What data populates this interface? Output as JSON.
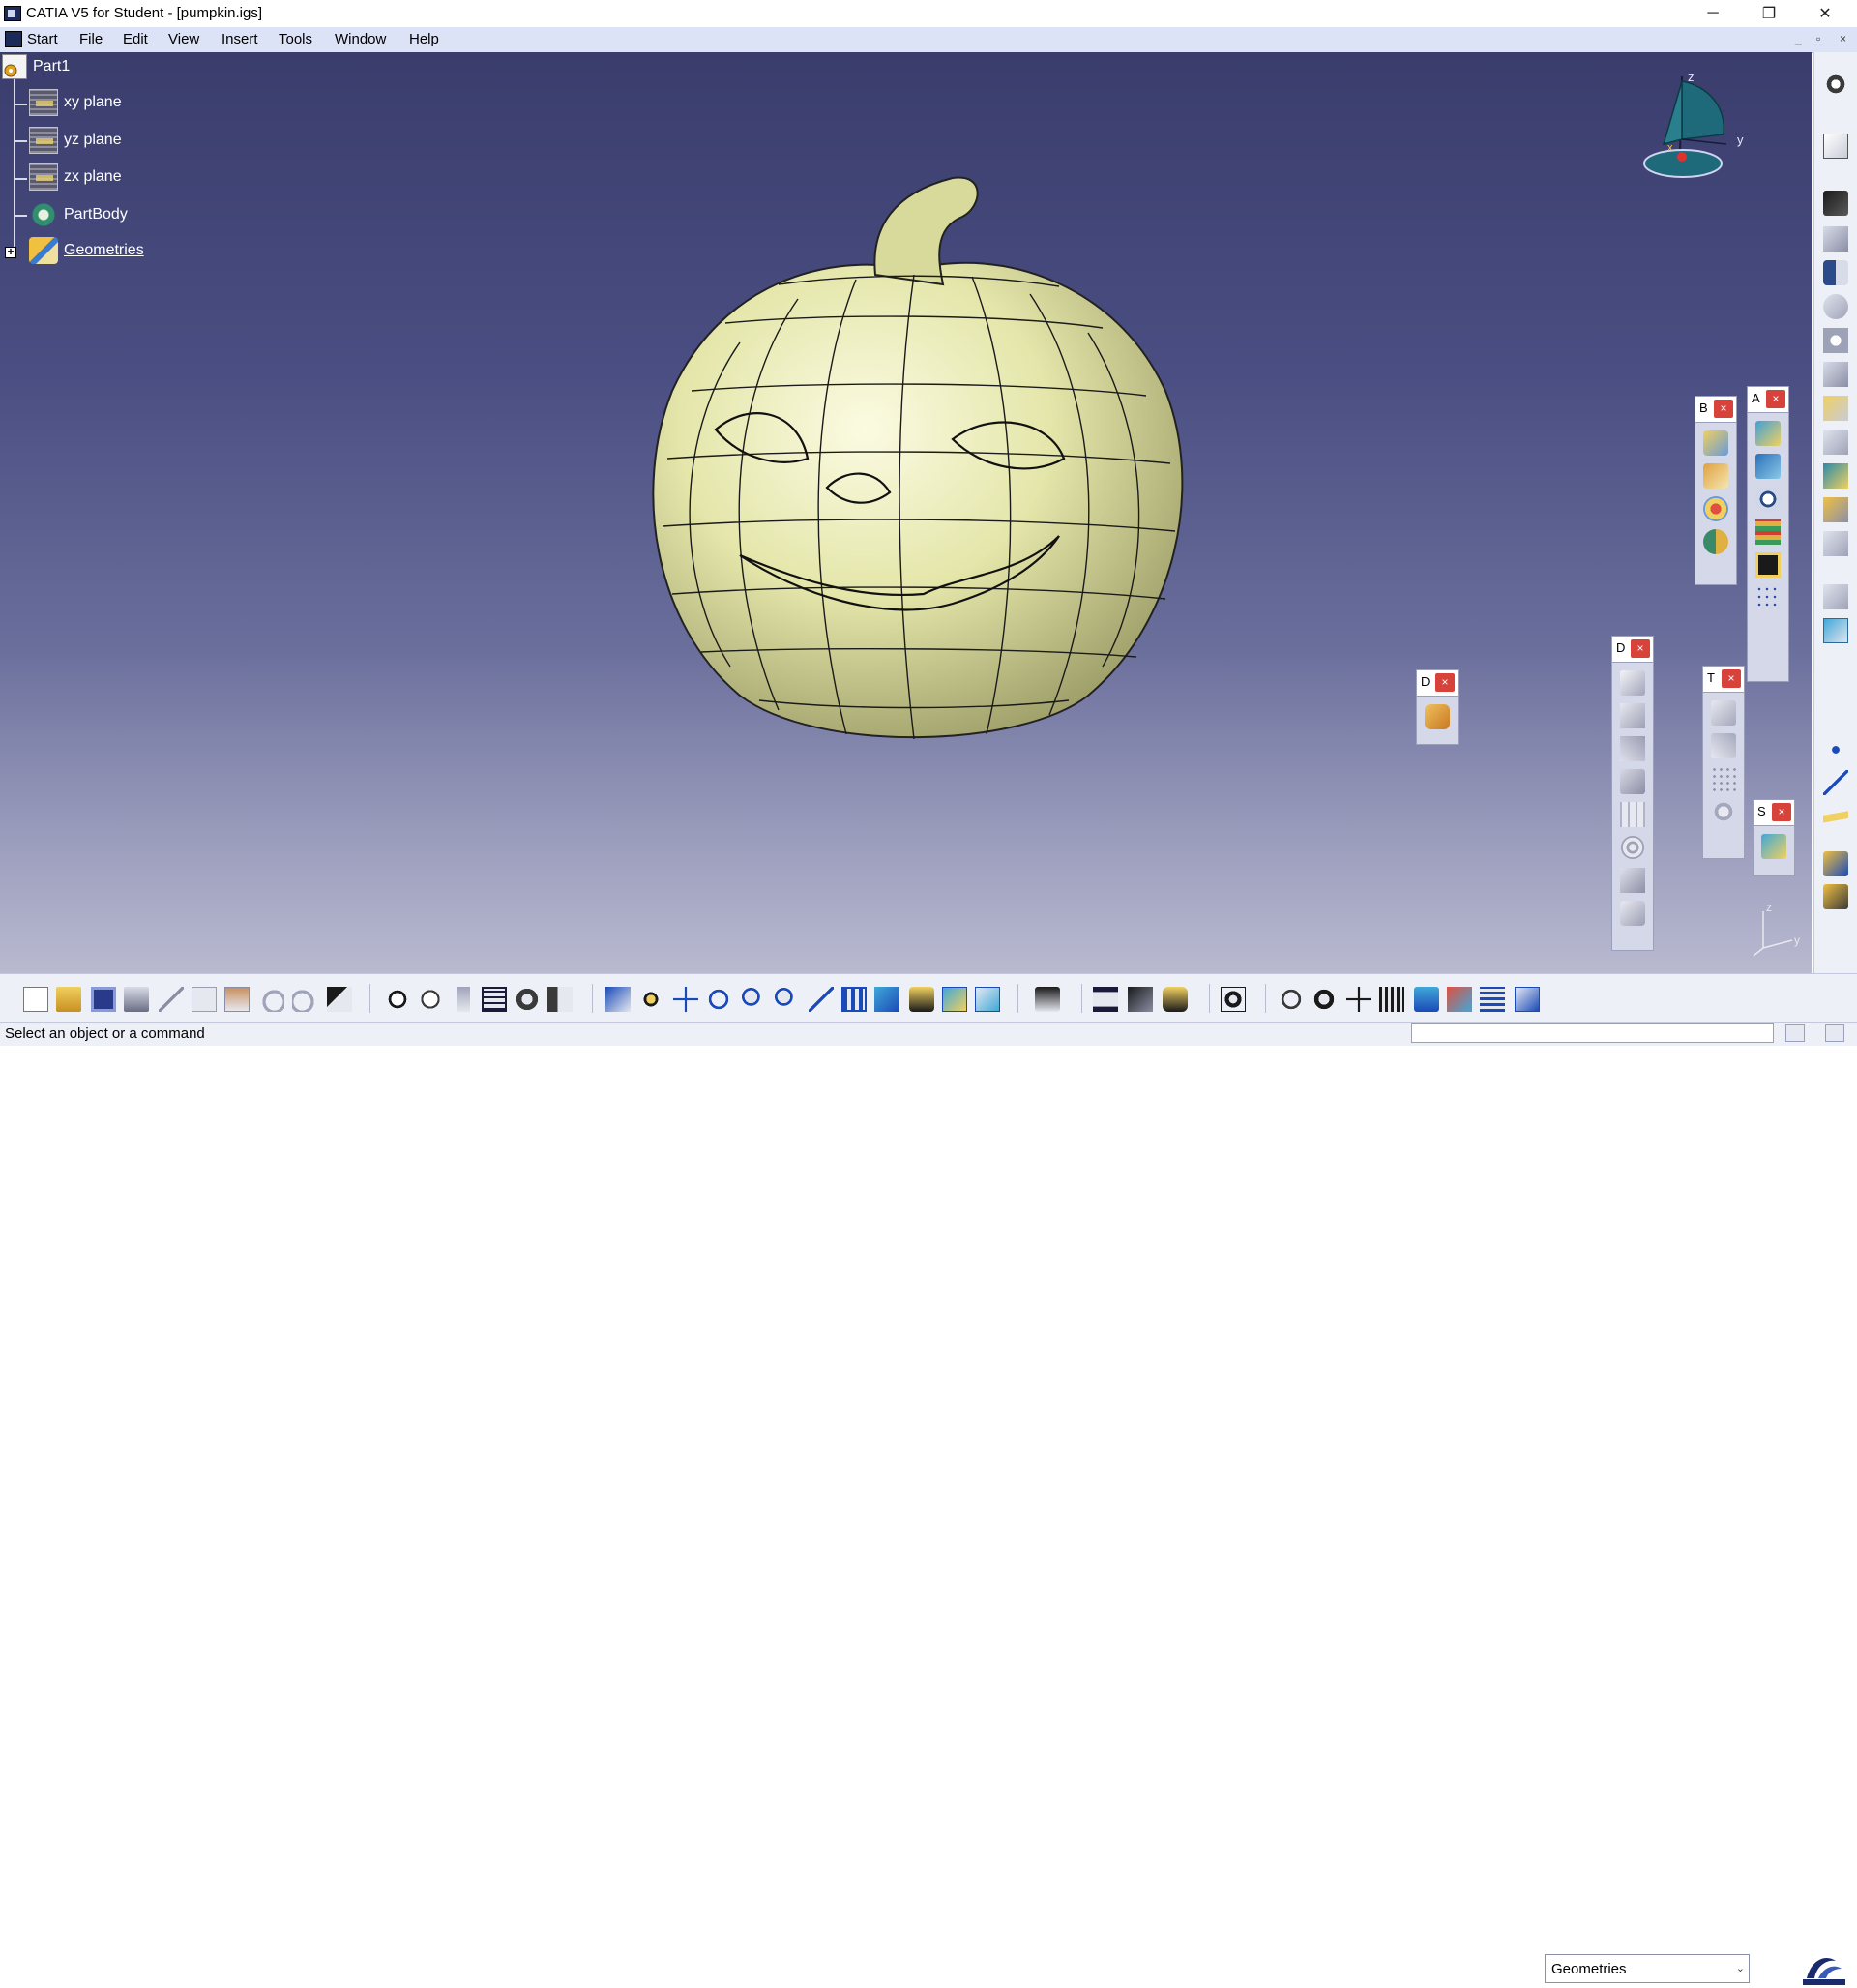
{
  "window": {
    "title": "CATIA V5 for Student - [pumpkin.igs]",
    "minimize": "─",
    "restore": "❐",
    "close": "✕"
  },
  "menu": {
    "start": "Start",
    "items": [
      "File",
      "Edit",
      "View",
      "Insert",
      "Tools",
      "Window",
      "Help"
    ],
    "mdi_min": "_",
    "mdi_restore": "▫",
    "mdi_close": "×"
  },
  "tree": {
    "root": "Part1",
    "items": [
      "xy plane",
      "yz plane",
      "zx plane",
      "PartBody",
      "Geometries"
    ],
    "expand_symbol": "+"
  },
  "compass": {
    "z": "z",
    "y": "y",
    "x": "x"
  },
  "axis_small": {
    "z": "z",
    "y": "y"
  },
  "panels": {
    "b": "B",
    "a": "A",
    "d1": "D",
    "d2": "D",
    "t": "T",
    "s": "S",
    "close": "×"
  },
  "toolbar": {
    "workbench_combo": "Geometries",
    "combo_arrow": "⌄"
  },
  "status": {
    "message": "Select an object or a command"
  },
  "colors": {
    "pumpkin": "#e6e8b0",
    "viewport_top": "#3a3d6c",
    "viewport_bottom": "#b9bad0",
    "menubar": "#dde3f7",
    "panel_close": "#d7433b"
  }
}
